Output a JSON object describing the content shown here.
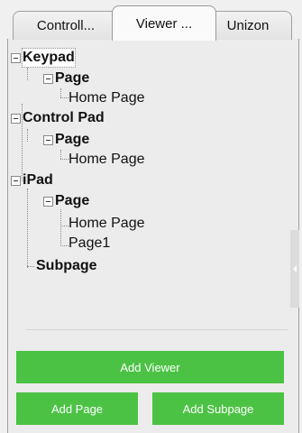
{
  "tabs": [
    {
      "label": "Controll..."
    },
    {
      "label": "Viewer ..."
    },
    {
      "label": "Unizon"
    }
  ],
  "active_tab": "Viewer ...",
  "tree": {
    "keypad": {
      "label": "Keypad",
      "page": {
        "label": "Page",
        "children": [
          "Home Page"
        ]
      }
    },
    "control_pad": {
      "label": "Control Pad",
      "page": {
        "label": "Page",
        "children": [
          "Home Page"
        ]
      }
    },
    "ipad": {
      "label": "iPad",
      "page": {
        "label": "Page",
        "children": [
          "Home Page",
          "Page1"
        ]
      },
      "subpage": {
        "label": "Subpage"
      }
    }
  },
  "buttons": {
    "add_viewer": "Add Viewer",
    "add_page": "Add Page",
    "add_subpage": "Add Subpage"
  },
  "colors": {
    "button_green": "#4cc245",
    "button_text": "#ffffff",
    "panel_bg": "#ececec"
  },
  "icons": {
    "expander": "minus-box-icon",
    "collapse_handle": "chevron-left-icon"
  }
}
